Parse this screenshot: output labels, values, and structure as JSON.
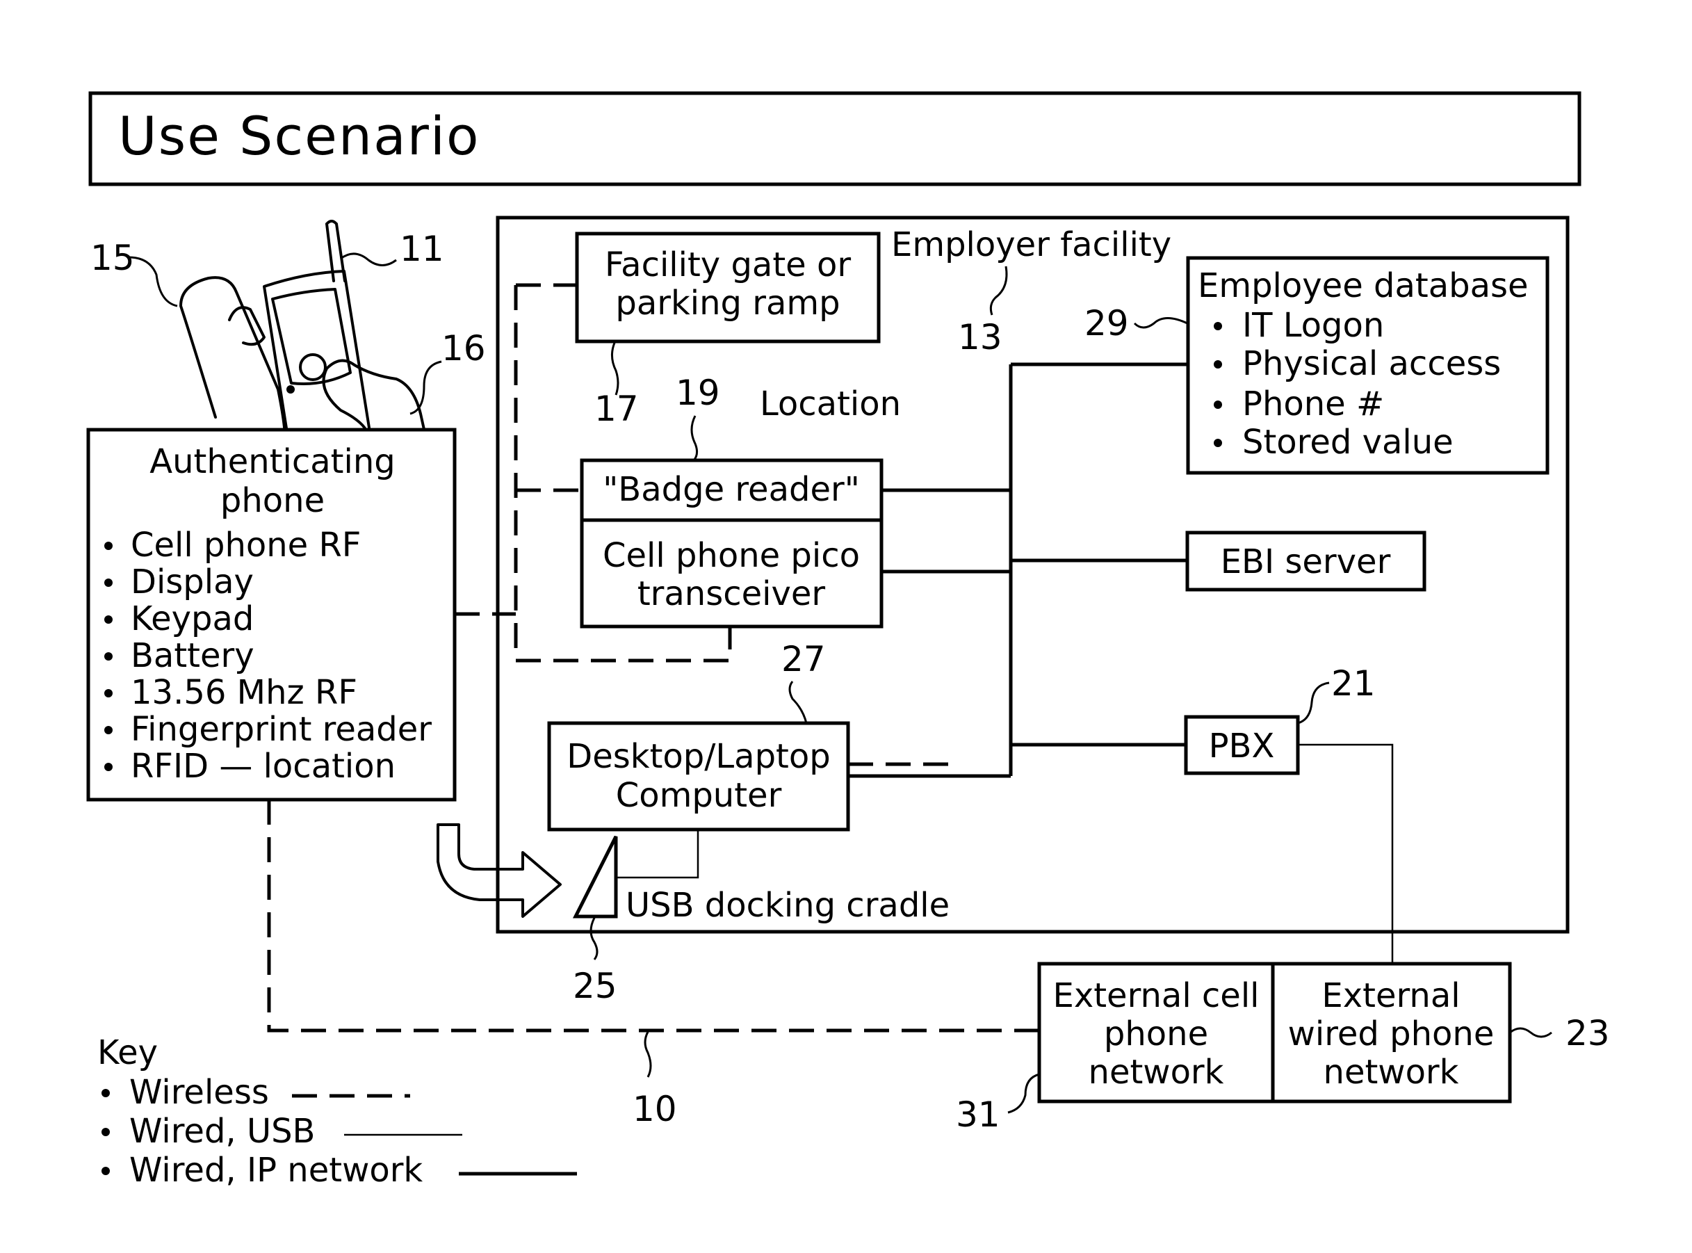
{
  "title": "Use Scenario",
  "employer_facility": {
    "label": "Employer facility",
    "ref": "13"
  },
  "phone_illustration": {
    "refs": {
      "phone": "11",
      "hand_left": "15",
      "hand_right": "16"
    }
  },
  "auth_phone": {
    "title_lines": [
      "Authenticating",
      "phone"
    ],
    "features": [
      "Cell phone RF",
      "Display",
      "Keypad",
      "Battery",
      "13.56 Mhz RF",
      "Fingerprint reader",
      "RFID — location"
    ]
  },
  "facility_gate": {
    "lines": [
      "Facility gate or",
      "parking ramp"
    ],
    "ref": "17"
  },
  "badge_reader": {
    "label": "\"Badge reader\"",
    "ref": "19",
    "location_label": "Location"
  },
  "pico": {
    "lines": [
      "Cell phone pico",
      "transceiver"
    ]
  },
  "employee_db": {
    "title": "Employee database",
    "items": [
      "IT Logon",
      "Physical access",
      "Phone #",
      "Stored value"
    ],
    "ref": "29"
  },
  "ebi_server": {
    "label": "EBI server"
  },
  "pbx": {
    "label": "PBX",
    "ref": "21"
  },
  "computer": {
    "lines": [
      "Desktop/Laptop",
      "Computer"
    ],
    "ref": "27"
  },
  "cradle": {
    "label": "USB docking cradle",
    "ref": "25"
  },
  "ext_cell": {
    "lines": [
      "External cell",
      "phone",
      "network"
    ],
    "ref": "31"
  },
  "ext_wired": {
    "lines": [
      "External",
      "wired phone",
      "network"
    ],
    "ref": "23"
  },
  "wireless_link_ref": "10",
  "key": {
    "title": "Key",
    "items": [
      {
        "label": "Wireless",
        "style": "dashed"
      },
      {
        "label": "Wired, USB",
        "style": "thin"
      },
      {
        "label": "Wired, IP network",
        "style": "thick"
      }
    ]
  }
}
